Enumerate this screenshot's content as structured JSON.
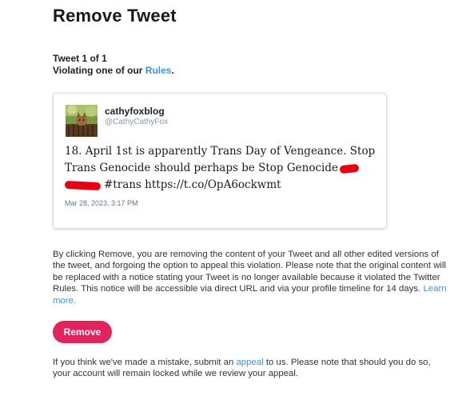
{
  "page": {
    "title": "Remove Tweet"
  },
  "meta": {
    "tweet_counter": "Tweet 1 of 1",
    "violation_prefix": "Violating one of our",
    "rules_link": "Rules",
    "violation_suffix": "."
  },
  "tweet": {
    "display_name": "cathyfoxblog",
    "handle": "@CathyCathyFox",
    "avatar_icon": "fox-photo-avatar",
    "text_part1": "18. April 1st is apparently Trans Day of Vengeance. Stop Trans Genocide should perhaps be Stop Genocide",
    "text_part2": "#trans https://t.co/OpA6ockwmt",
    "timestamp": "Mar 28, 2023, 3:17 PM",
    "redaction_color": "#e60012"
  },
  "explanation": {
    "text": "By clicking Remove, you are removing the content of your Tweet and all other edited versions of the tweet, and forgoing the option to appeal this violation. Please note that the original content will be replaced with a notice stating your Tweet is no longer available because it violated the Twitter Rules. This notice will be accessible via direct URL and via your profile timeline for 14 days.",
    "learn_more": "Learn more."
  },
  "remove_button": {
    "label": "Remove",
    "color": "#e0245e"
  },
  "footer": {
    "prefix": "If you think we've made a mistake, submit an",
    "appeal_link": "appeal",
    "suffix": "to us. Please note that should you do so, your account will remain locked while we review your appeal."
  },
  "colors": {
    "link": "#3b94d9",
    "card_border": "#dcdcdc"
  }
}
